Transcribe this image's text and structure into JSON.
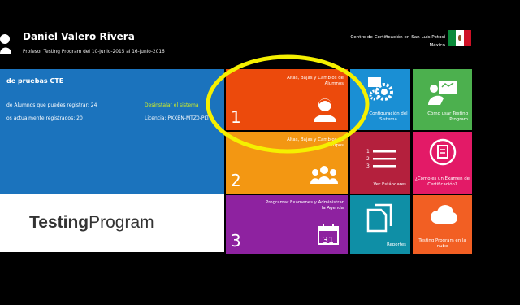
{
  "header": {
    "user_name": "Daniel Valero Rivera",
    "user_period": "Profesor Testing Program del 10-junio-2015 al 16-junio-2016",
    "cert_center": "Centro de Certificación en San Luis Potosí",
    "cert_country": "México"
  },
  "info": {
    "title": "de pruebas CTE",
    "registrable": "de Alumnos que puedes registrar: 24",
    "uninstall": "Desinstalar el sistema",
    "current": "os actualmente registrados: 20",
    "license": "Licencia: PXXBN-MTZ0-PLTS"
  },
  "logo": {
    "bold": "Testing",
    "light": "Program"
  },
  "tiles": {
    "t1": {
      "label": "Altas, Bajas y Cambios de Alumnos",
      "number": "1"
    },
    "t2": {
      "label": "Altas, Bajas y Cambios de Grupos",
      "number": "2"
    },
    "t3": {
      "label": "Programar Exámenes y Administrar la Agenda",
      "number": "3",
      "calendar_day": "31"
    },
    "config": "Configuración del Sistema",
    "howto": "Cómo usar Testing Program",
    "standards": "Ver Estándares",
    "standards_list": [
      "1",
      "2",
      "3"
    ],
    "exam": "¿Cómo es un Examen de Certificación?",
    "reports": "Reportes",
    "cloud": "Testing Program en la nube"
  },
  "colors": {
    "tile1": "#ec4a0c",
    "tile2": "#f39712",
    "tile3": "#8e22a0",
    "info": "#1b73bd",
    "annotation": "#f5f000"
  }
}
